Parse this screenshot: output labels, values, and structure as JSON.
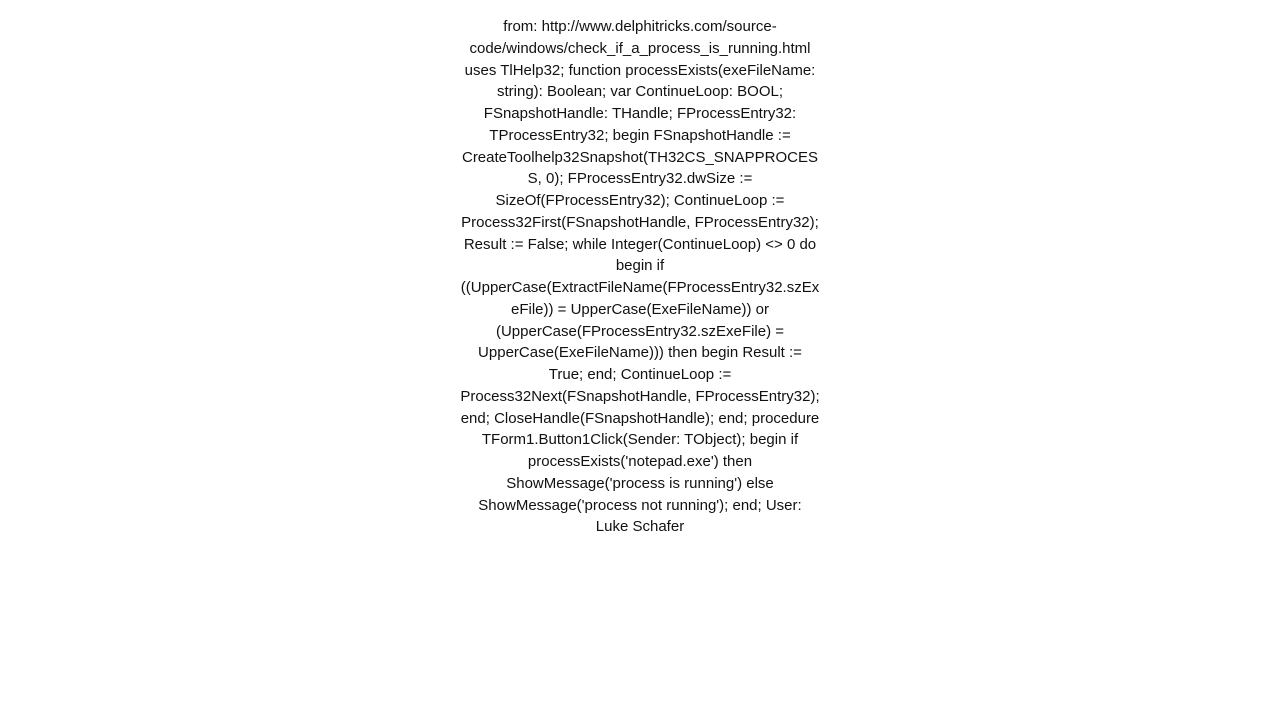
{
  "content": {
    "text": "from: http://www.delphitricks.com/source-code/windows/check_if_a_process_is_running.html uses TlHelp32;      function processExists(exeFileName: string): Boolean;  var    ContinueLoop: BOOL;    FSnapshotHandle: THandle;    FProcessEntry32: TProcessEntry32;  begin    FSnapshotHandle := CreateToolhelp32Snapshot(TH32CS_SNAPPROCESS, 0);    FProcessEntry32.dwSize := SizeOf(FProcessEntry32);    ContinueLoop := Process32First(FSnapshotHandle, FProcessEntry32);    Result := False;    while Integer(ContinueLoop) <> 0 do    begin      if ((UpperCase(ExtractFileName(FProcessEntry32.szExeFile)) =        UpperCase(ExeFileName)) or (UpperCase(FProcessEntry32.szExeFile) =        UpperCase(ExeFileName))) then      begin        Result := True;      end;      ContinueLoop := Process32Next(FSnapshotHandle, FProcessEntry32);    end;    CloseHandle(FSnapshotHandle);  end;    procedure TForm1.Button1Click(Sender: TObject);  begin    if processExists('notepad.exe') then      ShowMessage('process is running')    else      ShowMessage('process not running');  end;   User: Luke Schafer"
  }
}
